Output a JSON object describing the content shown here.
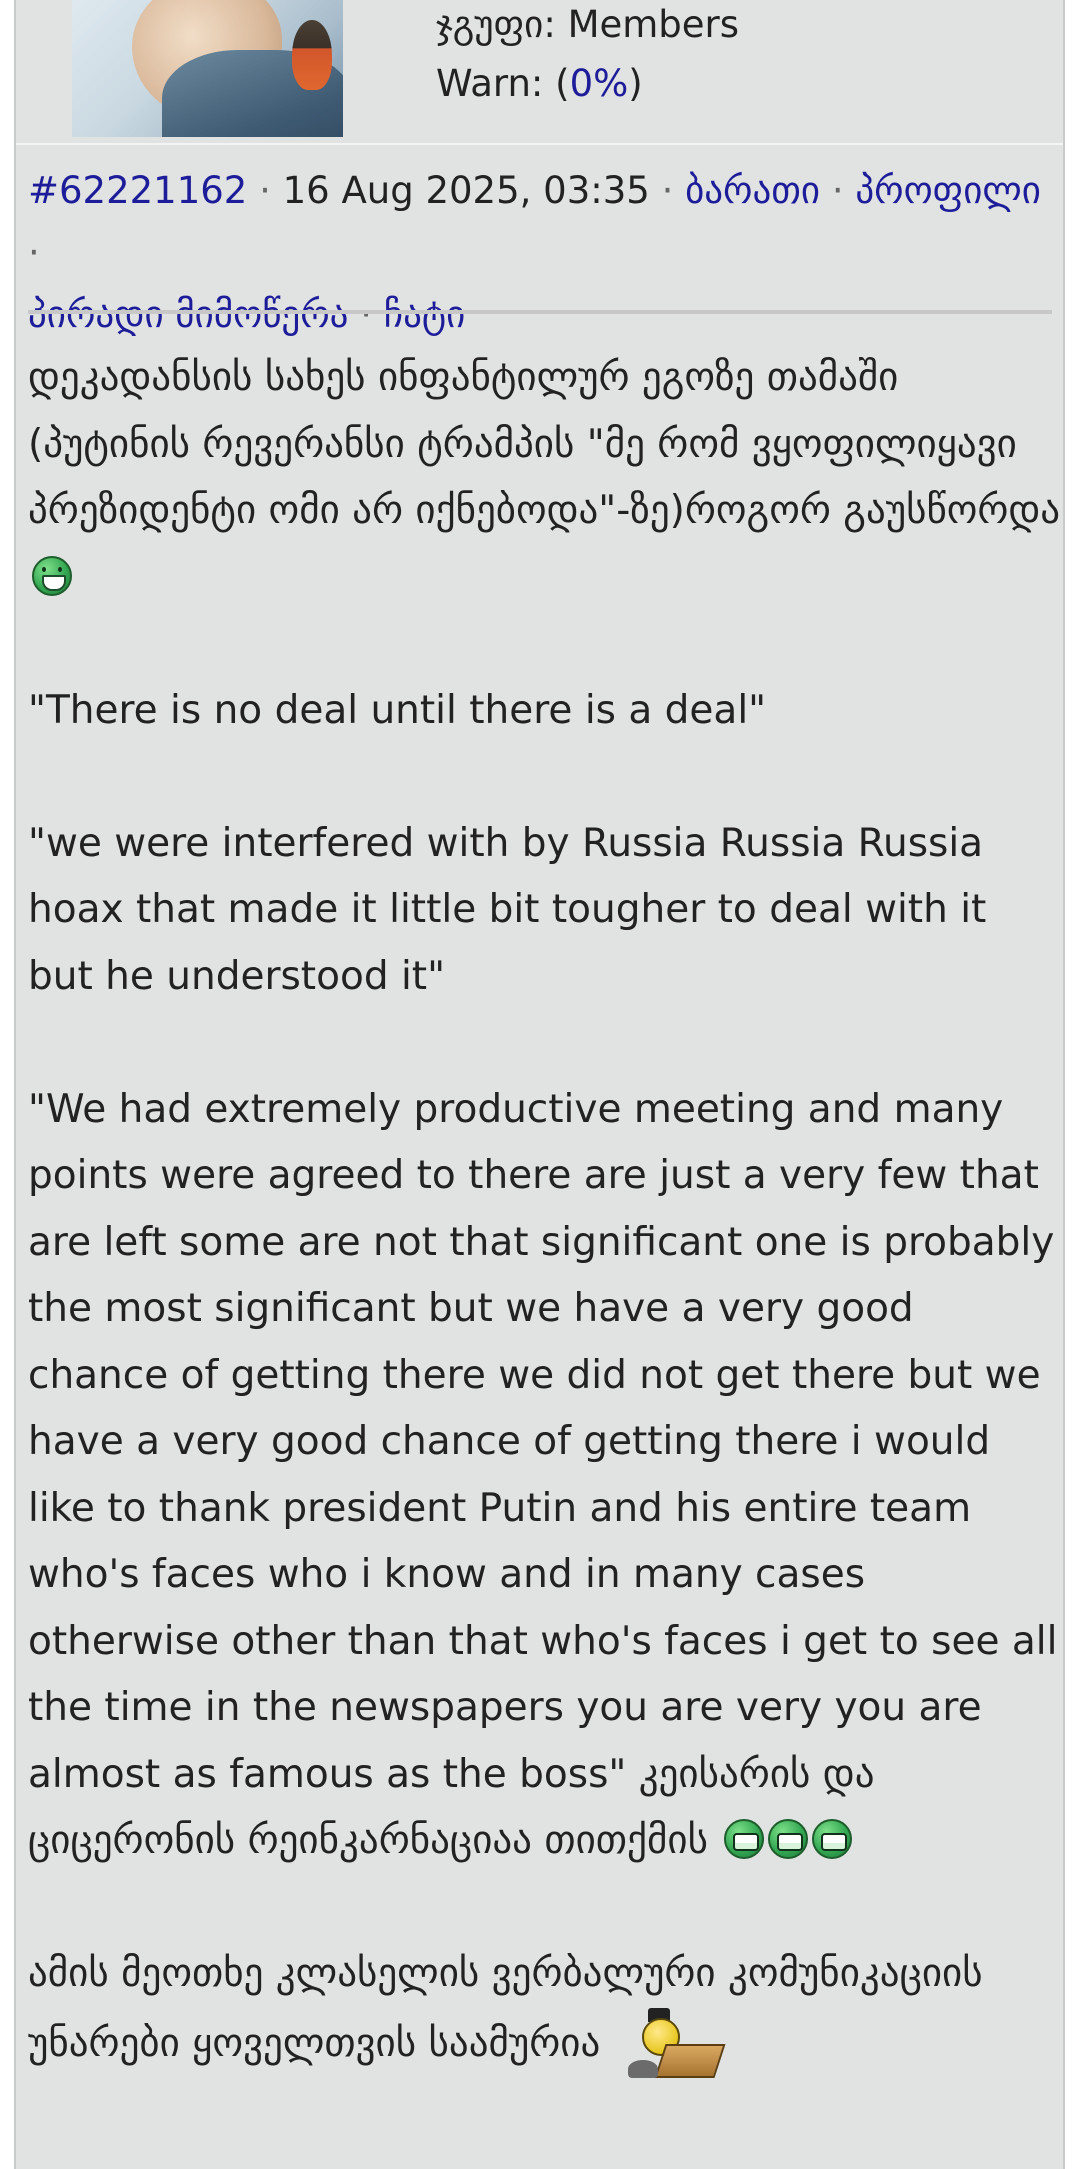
{
  "user": {
    "group_label": "ჯგუფი",
    "group_value": "Members",
    "warn_label": "Warn:",
    "warn_open": "(",
    "warn_value": "0%",
    "warn_close": ")"
  },
  "post": {
    "id": "#62221162",
    "date": "16 Aug 2025, 03:35",
    "separator": "·",
    "links": {
      "card": "ბარათი",
      "profile": "პროფილი",
      "pm": "პირადი მიმოწერა",
      "chat": "ჩატი"
    },
    "paragraphs": {
      "p1": "დეკადანსის სახეს ინფანტილურ ეგოზე თამაში (პუტინის რევერანსი ტრამპის \"მე რომ ვყოფილიყავი პრეზიდენტი ომი არ იქნებოდა\"-ზე)როგორ გაუსწორდა",
      "p2": "\"There is no deal until there is a deal\"",
      "p3": "\"we were interfered with by Russia Russia Russia hoax that made it little bit tougher to deal with it but he understood it\"",
      "p4": "\"We had extremely productive meeting and many points were agreed to there are just a very few that are left some are not that significant one is probably the most significant but we have a very good chance of getting there we did not get there but we have a very good chance of getting there i would like to thank president Putin and his entire team who's faces who i know and in many cases otherwise other than that who's faces i get to see all the time in the newspapers you are very you are almost as famous as the boss\" კეისარის და ციცერონის რეინკარნაციაა თითქმის",
      "p5": "ამის მეოთხე კლასელის ვერბალური კომუნიკაციის უნარები ყოველთვის საამურია"
    }
  },
  "icons": {
    "grin": "grin-smiley-icon",
    "laugh": "laugh-smiley-icon",
    "scholar": "scholar-smiley-icon"
  },
  "colors": {
    "background": "#e1e2e2",
    "link": "#1d1d9a",
    "text": "#222222"
  }
}
